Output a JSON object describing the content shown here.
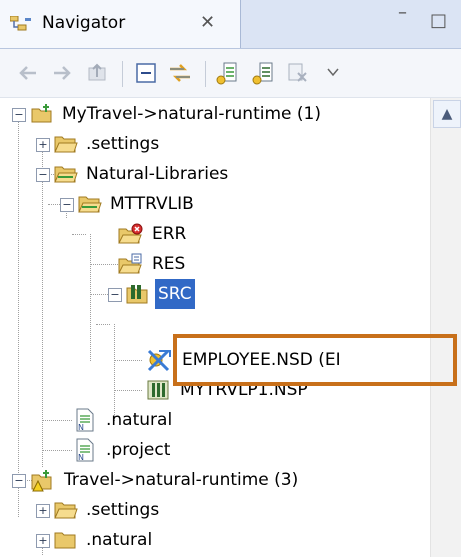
{
  "view": {
    "title": "Navigator",
    "close_glyph": "✕",
    "minimize_glyph": "–",
    "maximize_glyph": "□"
  },
  "toolbar": {
    "buttons": [
      "back-icon",
      "forward-icon",
      "up-icon",
      "collapse-all-icon",
      "link-with-editor-icon",
      "new-source-icon",
      "new-program-icon",
      "filter-icon",
      "view-menu-icon"
    ]
  },
  "tree": {
    "project1": {
      "label": "MyTravel->natural-runtime (1)"
    },
    "settings1": {
      "label": ".settings"
    },
    "natural_libraries": {
      "label": "Natural-Libraries"
    },
    "mttrvlib": {
      "label": "MTTRVLIB"
    },
    "err": {
      "label": "ERR"
    },
    "res": {
      "label": "RES"
    },
    "src": {
      "label": "SRC"
    },
    "employee": {
      "label": "EMPLOYEE.NSD (EI"
    },
    "mytrvlp1": {
      "label": "MYTRVLP1.NSP"
    },
    "natural": {
      "label": ".natural"
    },
    "project_file": {
      "label": ".project"
    },
    "project2": {
      "label": "Travel->natural-runtime (3)"
    },
    "settings2": {
      "label": ".settings"
    },
    "partial": {
      "label": ".natural"
    }
  },
  "colors": {
    "selection": "#3169c6",
    "callout": "#c8701a",
    "folder": "#e9c86a"
  }
}
